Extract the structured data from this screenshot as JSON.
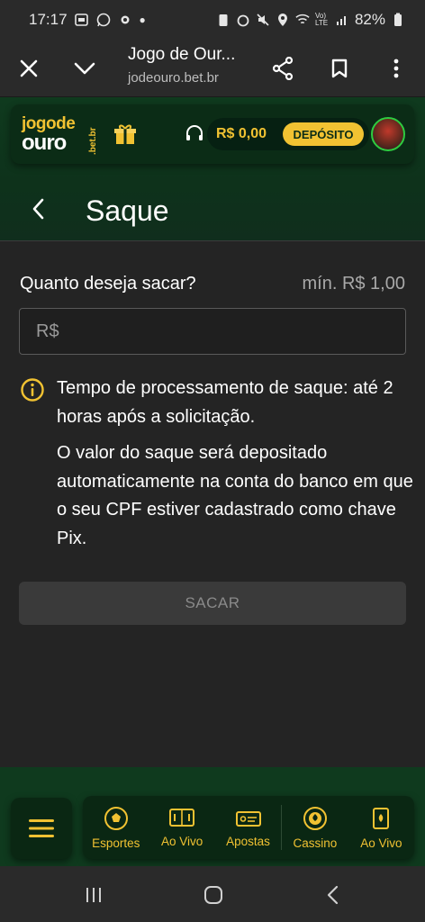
{
  "status_bar": {
    "time": "17:17",
    "battery": "82%",
    "network": "Vo) LTE"
  },
  "browser": {
    "title": "Jogo de Our...",
    "url": "jodeouro.bet.br"
  },
  "site_header": {
    "logo_line1": "jogode",
    "logo_line2": "ouro",
    "logo_tag": ".bet.br",
    "balance": "R$ 0,00",
    "deposit_label": "DEPÓSITO"
  },
  "page": {
    "title": "Saque"
  },
  "form": {
    "question": "Quanto deseja sacar?",
    "min_label": "mín. R$ 1,00",
    "amount_placeholder": "R$",
    "info_line1": "Tempo de processamento de saque: até 2 horas após a solicitação.",
    "info_line2": "O valor do saque será depositado automaticamente na conta do banco em que o seu CPF estiver cadastrado como chave Pix.",
    "submit_label": "SACAR"
  },
  "bottom_nav": {
    "items": [
      {
        "label": "Esportes",
        "icon": "soccer-ball-icon"
      },
      {
        "label": "Ao Vivo",
        "icon": "live-field-icon"
      },
      {
        "label": "Apostas",
        "icon": "ticket-icon"
      },
      {
        "label": "Cassino",
        "icon": "casino-chip-icon"
      },
      {
        "label": "Ao Vivo",
        "icon": "playing-card-icon"
      }
    ]
  },
  "colors": {
    "accent": "#f1c232",
    "brand_green": "#0b2c16",
    "background": "#242424"
  }
}
